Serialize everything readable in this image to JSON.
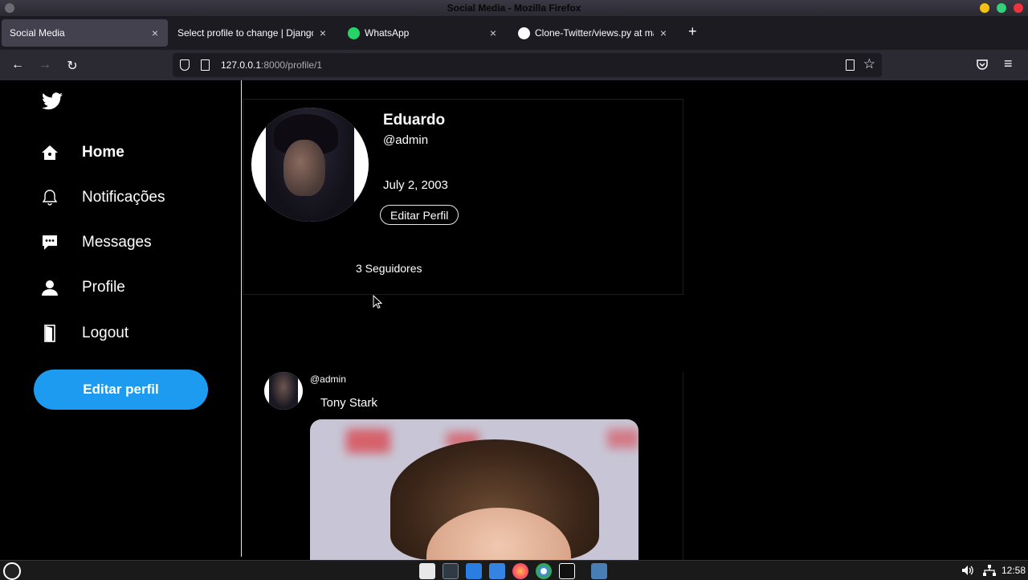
{
  "window": {
    "title": "Social Media - Mozilla Firefox"
  },
  "tabs": [
    {
      "label": "Social Media",
      "active": true,
      "icon": "none"
    },
    {
      "label": "Select profile to change | Django sit",
      "active": false,
      "icon": "none"
    },
    {
      "label": "WhatsApp",
      "active": false,
      "icon": "whatsapp-icon"
    },
    {
      "label": "Clone-Twitter/views.py at maste",
      "active": false,
      "icon": "github-icon"
    }
  ],
  "tab_close_glyph": "×",
  "new_tab_glyph": "+",
  "nav": {
    "back_glyph": "←",
    "forward_glyph": "→",
    "reload_glyph": "↻",
    "url_host": "127.0.0.1",
    "url_rest": ":8000/profile/1",
    "star_glyph": "☆",
    "menu_glyph": "≡"
  },
  "sidebar": {
    "items": [
      {
        "label": "Home",
        "icon": "home-icon",
        "bold": true
      },
      {
        "label": "Notificações",
        "icon": "bell-icon",
        "bold": false
      },
      {
        "label": "Messages",
        "icon": "message-icon",
        "bold": false
      },
      {
        "label": "Profile",
        "icon": "user-icon",
        "bold": false
      },
      {
        "label": "Logout",
        "icon": "door-icon",
        "bold": false
      }
    ],
    "button_label": "Editar perfil"
  },
  "profile": {
    "name": "Eduardo",
    "handle": "@admin",
    "birthday": "July 2, 2003",
    "edit_label": "Editar Perfil",
    "followers": "3 Seguidores"
  },
  "tweet": {
    "handle": "@admin",
    "text": "Tony Stark"
  },
  "taskbar": {
    "time": "12:58"
  },
  "colors": {
    "accent": "#1d9bf0",
    "background": "#000000",
    "browser_chrome": "#2b2a33"
  }
}
